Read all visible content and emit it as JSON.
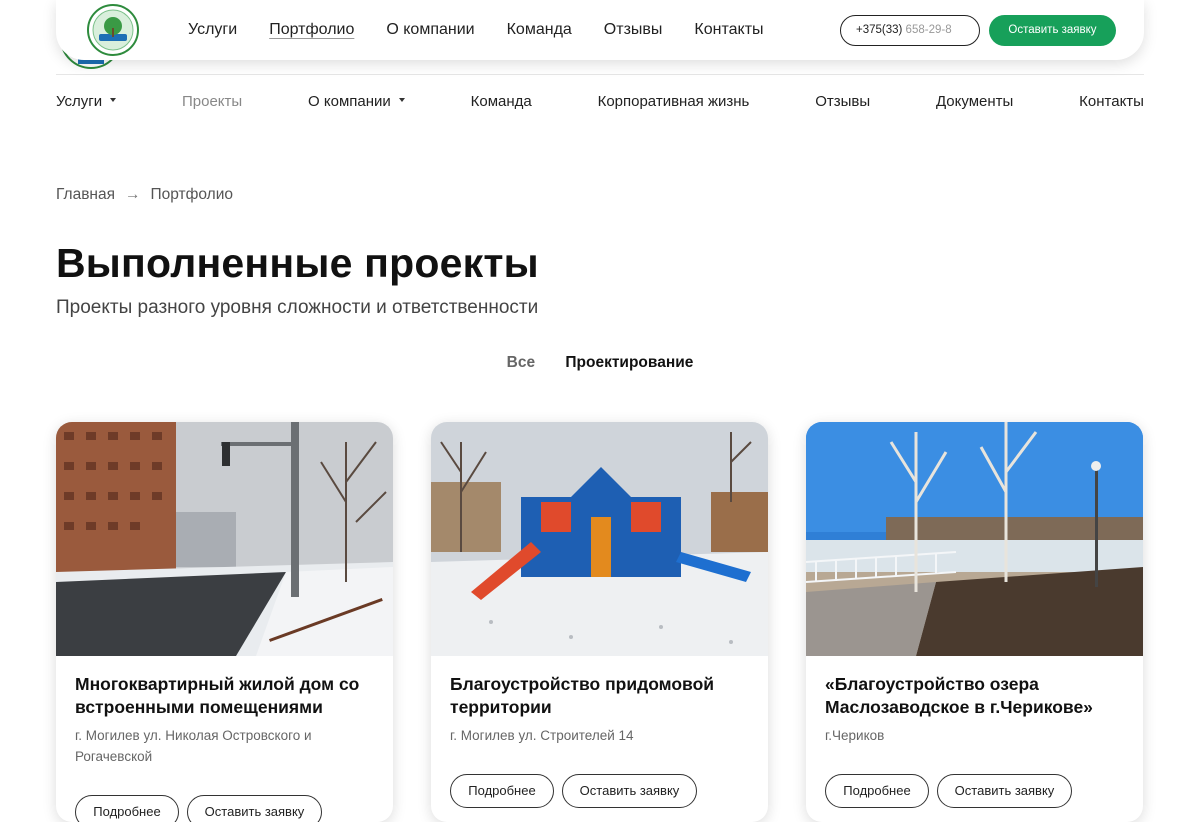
{
  "top_bar": {
    "nav": [
      "Услуги",
      "Портфолио",
      "О компании",
      "Команда",
      "Отзывы",
      "Контакты"
    ],
    "phone_main": "+375(33)",
    "phone_rest": " 658-29-8",
    "cta_label": "Оставить заявку"
  },
  "main_nav": [
    {
      "label": "Услуги"
    },
    {
      "label": "Проекты"
    },
    {
      "label": "О компании"
    },
    {
      "label": "Команда"
    },
    {
      "label": "Корпоративная жизнь"
    },
    {
      "label": "Отзывы"
    },
    {
      "label": "Документы"
    },
    {
      "label": "Контакты"
    }
  ],
  "breadcrumb": {
    "home": "Главная",
    "arrow": "→",
    "current": "Портфолио"
  },
  "page": {
    "title": "Выполненные проекты",
    "subtitle": "Проекты разного уровня сложности и ответственности"
  },
  "filters": {
    "all": "Все",
    "design": "Проектирование"
  },
  "cards": [
    {
      "title": "Многоквартирный жилой дом со встроенными помещениями",
      "address": "г. Могилев ул. Николая Островского и Рогачевской",
      "more_label": "Подробнее",
      "order_label": "Оставить заявку"
    },
    {
      "title": "Благоустройство придомовой территории",
      "address": "г. Могилев ул. Строителей 14",
      "more_label": "Подробнее",
      "order_label": "Оставить заявку"
    },
    {
      "title": "«Благоустройство озера Маслозаводское в г.Черикове»",
      "address": "г.Чериков",
      "more_label": "Подробнее",
      "order_label": "Оставить заявку"
    }
  ],
  "colors": {
    "accent": "#17a05a",
    "text": "#111111",
    "muted": "#888888"
  }
}
